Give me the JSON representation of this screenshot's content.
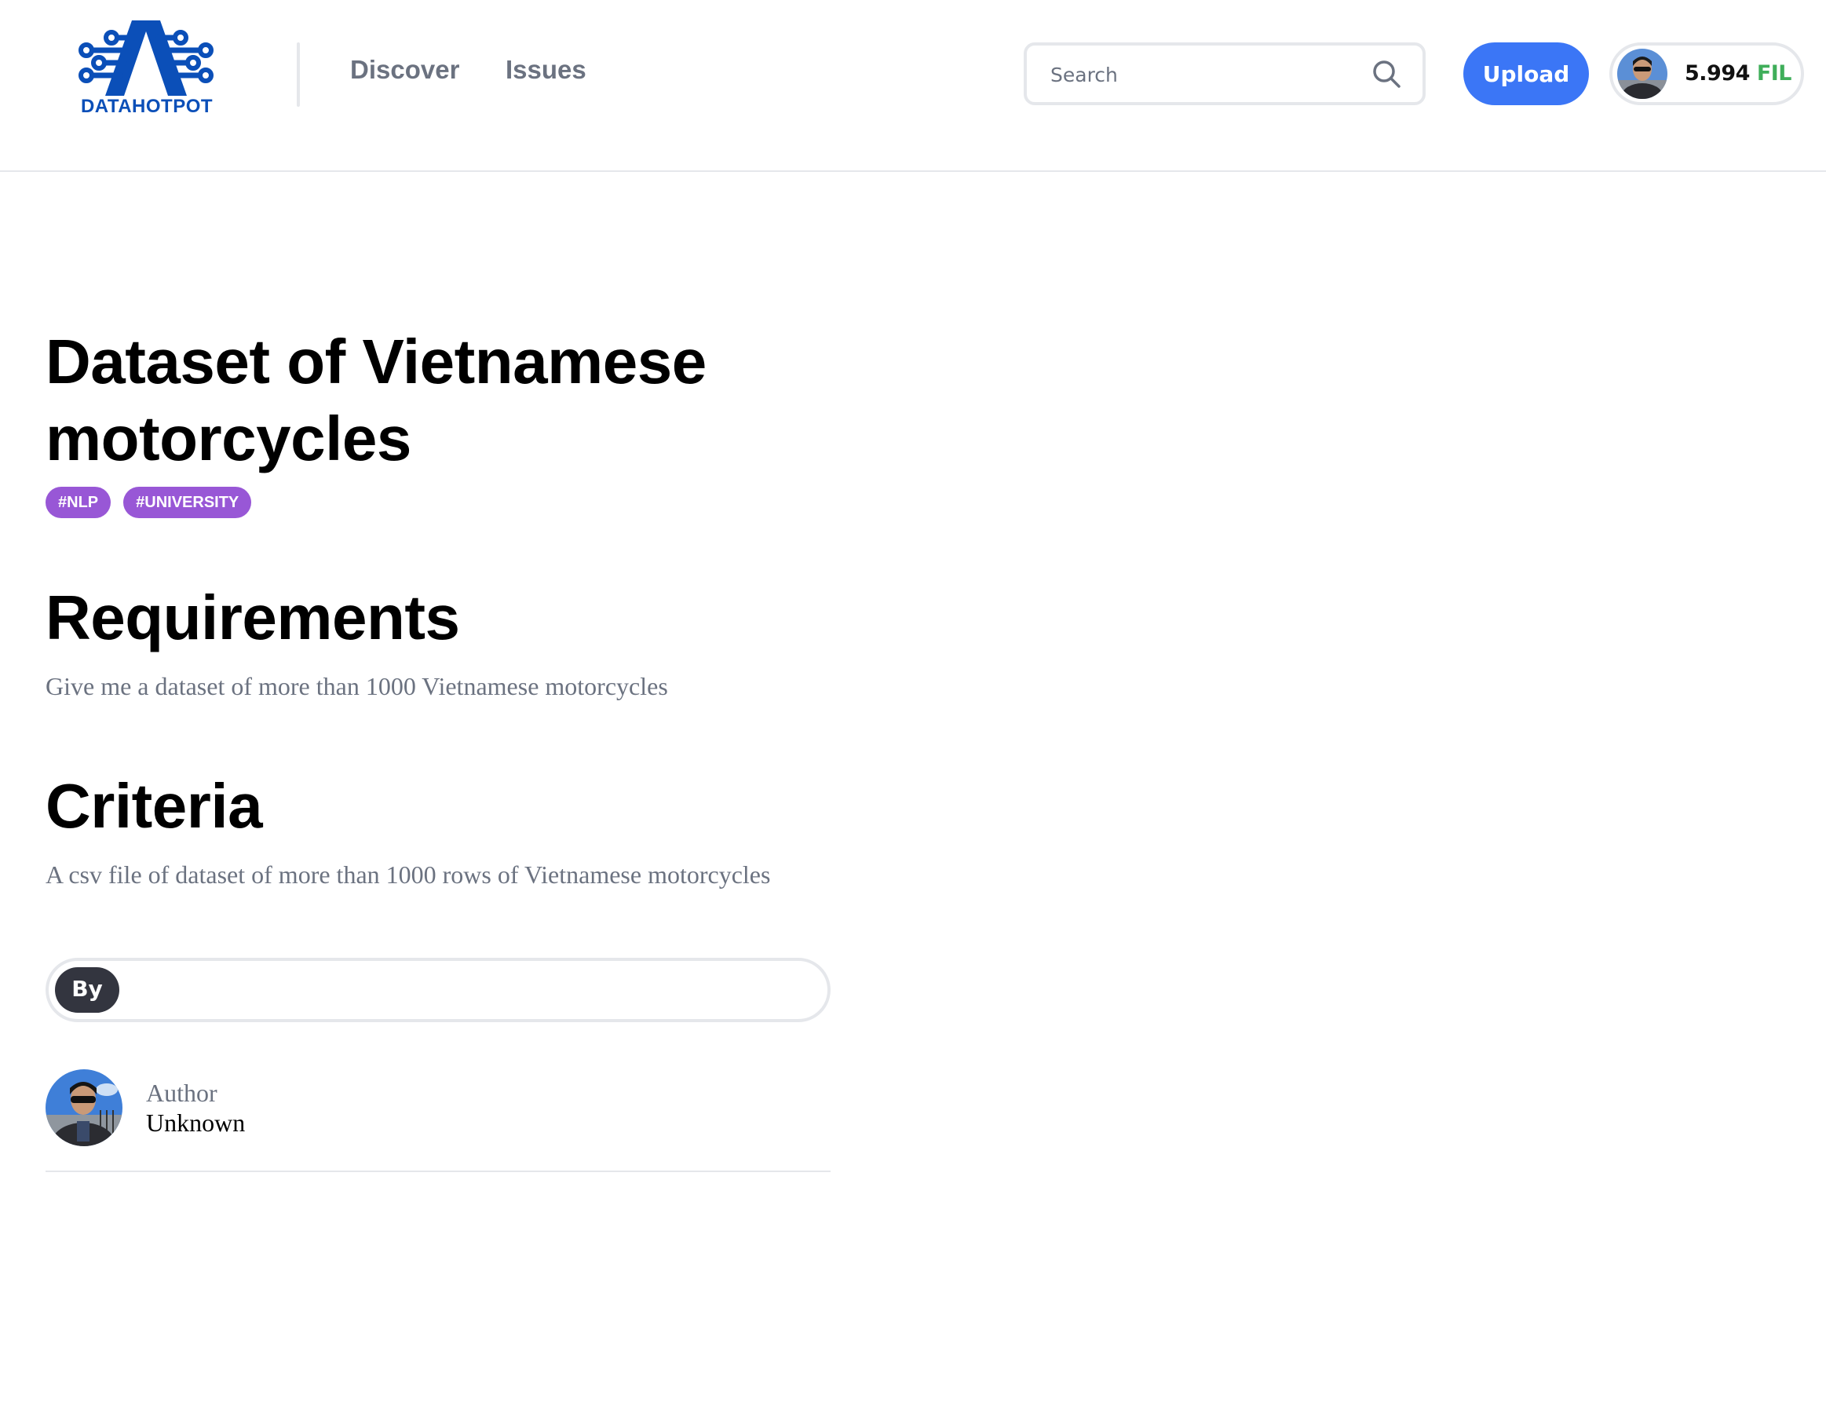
{
  "header": {
    "logo_text": "DATAHOTPOT",
    "nav": [
      {
        "label": "Discover"
      },
      {
        "label": "Issues"
      }
    ],
    "search": {
      "placeholder": "Search",
      "value": "",
      "icon": "search-icon"
    },
    "upload_label": "Upload",
    "wallet": {
      "amount": "5.994",
      "unit": "FIL"
    }
  },
  "colors": {
    "brand_blue": "#0b4fb8",
    "upload_blue": "#3b76f6",
    "tag_purple": "#9857d6",
    "fil_green": "#3fae5a",
    "muted_text": "#6b7280"
  },
  "issue": {
    "title": "Dataset of Vietnamese motorcycles",
    "tags": [
      "#NLP",
      "#UNIVERSITY"
    ],
    "requirements": {
      "heading": "Requirements",
      "text": "Give me a dataset of more than 1000 Vietnamese motorcycles"
    },
    "criteria": {
      "heading": "Criteria",
      "text": "A csv file of dataset of more than 1000 rows of Vietnamese motorcycles"
    },
    "by_label": "By",
    "author": {
      "label": "Author",
      "name": "Unknown"
    }
  }
}
